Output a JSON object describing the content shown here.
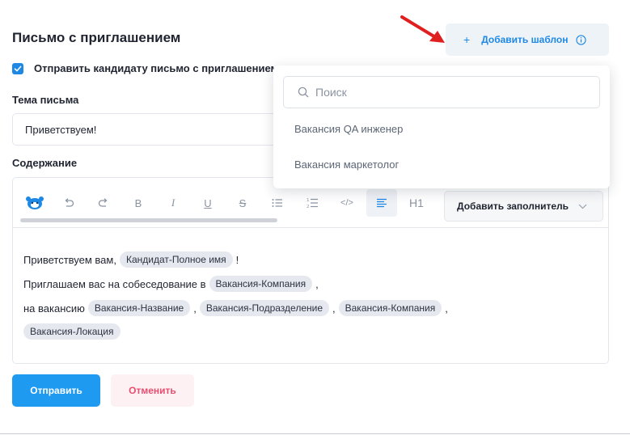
{
  "page": {
    "title": "Письмо с приглашением"
  },
  "header": {
    "add_template_label": "Добавить шаблон",
    "plus": "+"
  },
  "checkbox": {
    "label": "Отправить кандидату письмо с приглашением",
    "checked": true
  },
  "subject": {
    "label": "Тема письма",
    "value": "Приветствуем!"
  },
  "content": {
    "label": "Содержание"
  },
  "toolbar": {
    "bold": "B",
    "italic": "I",
    "underline": "U",
    "strike": "S",
    "code": "</>",
    "heading": "H1",
    "add_placeholder_label": "Добавить заполнитель"
  },
  "body": {
    "line1": {
      "text": "Приветствуем вам,",
      "tags": [
        "Кандидат-Полное имя"
      ],
      "suffix": "!"
    },
    "line2": {
      "text": "Приглашаем вас на собеседование в",
      "tags": [
        "Вакансия-Компания"
      ],
      "suffix": ","
    },
    "line3": {
      "text": "на вакансию",
      "tags": [
        "Вакансия-Название",
        "Вакансия-Подразделение",
        "Вакансия-Компания"
      ],
      "seps": [
        ",",
        ",",
        ","
      ]
    },
    "line4": {
      "tags": [
        "Вакансия-Локация"
      ]
    }
  },
  "actions": {
    "send_label": "Отправить",
    "cancel_label": "Отменить"
  },
  "dropdown": {
    "search_placeholder": "Поиск",
    "items": [
      "Вакансия QA инженер",
      "Вакансия маркетолог"
    ]
  },
  "colors": {
    "accent": "#1e9bf0",
    "link": "#1e88e5",
    "danger": "#e64d6e",
    "arrow": "#e02020"
  }
}
